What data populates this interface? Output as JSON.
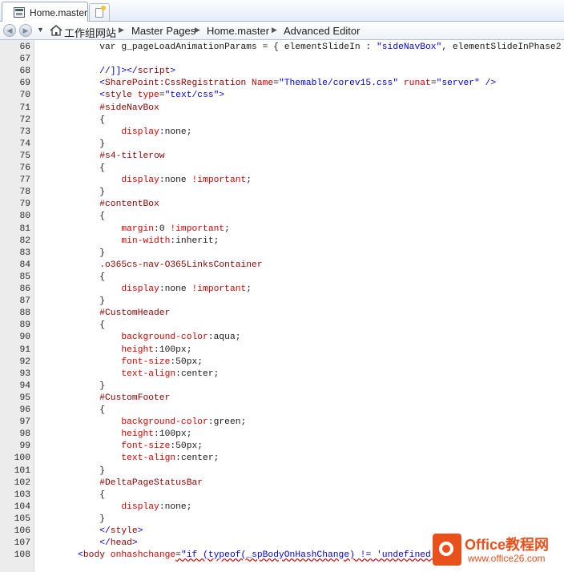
{
  "tab": {
    "label": "Home.master"
  },
  "breadcrumb": [
    "工作组网站",
    "Master Pages",
    "Home.master",
    "Advanced Editor"
  ],
  "code_lines": [
    {
      "n": "66",
      "t": [
        [
          "        var g_pageLoadAnimationParams = { elementSlideIn : ",
          "b"
        ],
        [
          "\"sideNavBox\"",
          "blue"
        ],
        [
          ", elementSlideInPhase2",
          "b"
        ]
      ]
    },
    {
      "n": "67",
      "t": []
    },
    {
      "n": "68",
      "t": [
        [
          "        //]]></",
          "blue"
        ],
        [
          "script",
          "maroon"
        ],
        [
          ">",
          "blue"
        ]
      ]
    },
    {
      "n": "69",
      "t": [
        [
          "        <",
          "blue"
        ],
        [
          "SharePoint:CssRegistration",
          "maroon"
        ],
        [
          " Name",
          "red"
        ],
        [
          "=",
          "b"
        ],
        [
          "\"Themable/corev15.css\"",
          "blue"
        ],
        [
          " runat",
          "red"
        ],
        [
          "=",
          "b"
        ],
        [
          "\"server\"",
          "blue"
        ],
        [
          " />",
          "blue"
        ]
      ]
    },
    {
      "n": "70",
      "t": [
        [
          "        <",
          "blue"
        ],
        [
          "style",
          "maroon"
        ],
        [
          " type",
          "red"
        ],
        [
          "=",
          "b"
        ],
        [
          "\"text/css\"",
          "blue"
        ],
        [
          ">",
          "blue"
        ]
      ]
    },
    {
      "n": "71",
      "t": [
        [
          "        #sideNavBox",
          "maroon"
        ]
      ]
    },
    {
      "n": "72",
      "t": [
        [
          "        {",
          "b"
        ]
      ]
    },
    {
      "n": "73",
      "t": [
        [
          "            display",
          "red"
        ],
        [
          ":",
          "b"
        ],
        [
          "none",
          "b"
        ],
        [
          ";",
          "b"
        ]
      ]
    },
    {
      "n": "74",
      "t": [
        [
          "        }",
          "b"
        ]
      ]
    },
    {
      "n": "75",
      "t": [
        [
          "        #s4-titlerow",
          "maroon"
        ]
      ]
    },
    {
      "n": "76",
      "t": [
        [
          "        {",
          "b"
        ]
      ]
    },
    {
      "n": "77",
      "t": [
        [
          "            display",
          "red"
        ],
        [
          ":",
          "b"
        ],
        [
          "none ",
          "b"
        ],
        [
          "!important",
          "red"
        ],
        [
          ";",
          "b"
        ]
      ]
    },
    {
      "n": "78",
      "t": [
        [
          "        }",
          "b"
        ]
      ]
    },
    {
      "n": "79",
      "t": [
        [
          "        #contentBox",
          "maroon"
        ]
      ]
    },
    {
      "n": "80",
      "t": [
        [
          "        {",
          "b"
        ]
      ]
    },
    {
      "n": "81",
      "t": [
        [
          "            margin",
          "red"
        ],
        [
          ":",
          "b"
        ],
        [
          "0 ",
          "b"
        ],
        [
          "!important",
          "red"
        ],
        [
          ";",
          "b"
        ]
      ]
    },
    {
      "n": "82",
      "t": [
        [
          "            min-width",
          "red"
        ],
        [
          ":",
          "b"
        ],
        [
          "inherit",
          "b"
        ],
        [
          ";",
          "b"
        ]
      ]
    },
    {
      "n": "83",
      "t": [
        [
          "        }",
          "b"
        ]
      ]
    },
    {
      "n": "84",
      "t": [
        [
          "        .o365cs-nav-O365LinksContainer",
          "maroon"
        ]
      ]
    },
    {
      "n": "85",
      "t": [
        [
          "        {",
          "b"
        ]
      ]
    },
    {
      "n": "86",
      "t": [
        [
          "            display",
          "red"
        ],
        [
          ":",
          "b"
        ],
        [
          "none ",
          "b"
        ],
        [
          "!important",
          "red"
        ],
        [
          ";",
          "b"
        ]
      ]
    },
    {
      "n": "87",
      "t": [
        [
          "        }",
          "b"
        ]
      ]
    },
    {
      "n": "88",
      "t": [
        [
          "        #CustomHeader",
          "maroon"
        ]
      ]
    },
    {
      "n": "89",
      "t": [
        [
          "        {",
          "b"
        ]
      ]
    },
    {
      "n": "90",
      "t": [
        [
          "            background-color",
          "red"
        ],
        [
          ":",
          "b"
        ],
        [
          "aqua",
          "b"
        ],
        [
          ";",
          "b"
        ]
      ]
    },
    {
      "n": "91",
      "t": [
        [
          "            height",
          "red"
        ],
        [
          ":",
          "b"
        ],
        [
          "100px",
          "b"
        ],
        [
          ";",
          "b"
        ]
      ]
    },
    {
      "n": "92",
      "t": [
        [
          "            font-size",
          "red"
        ],
        [
          ":",
          "b"
        ],
        [
          "50px",
          "b"
        ],
        [
          ";",
          "b"
        ]
      ]
    },
    {
      "n": "93",
      "t": [
        [
          "            text-align",
          "red"
        ],
        [
          ":",
          "b"
        ],
        [
          "center",
          "b"
        ],
        [
          ";",
          "b"
        ]
      ]
    },
    {
      "n": "94",
      "t": [
        [
          "        }",
          "b"
        ]
      ]
    },
    {
      "n": "95",
      "t": [
        [
          "        #CustomFooter",
          "maroon"
        ]
      ]
    },
    {
      "n": "96",
      "t": [
        [
          "        {",
          "b"
        ]
      ]
    },
    {
      "n": "97",
      "t": [
        [
          "            background-color",
          "red"
        ],
        [
          ":",
          "b"
        ],
        [
          "green",
          "b"
        ],
        [
          ";",
          "b"
        ]
      ]
    },
    {
      "n": "98",
      "t": [
        [
          "            height",
          "red"
        ],
        [
          ":",
          "b"
        ],
        [
          "100px",
          "b"
        ],
        [
          ";",
          "b"
        ]
      ]
    },
    {
      "n": "99",
      "t": [
        [
          "            font-size",
          "red"
        ],
        [
          ":",
          "b"
        ],
        [
          "50px",
          "b"
        ],
        [
          ";",
          "b"
        ]
      ]
    },
    {
      "n": "100",
      "t": [
        [
          "            text-align",
          "red"
        ],
        [
          ":",
          "b"
        ],
        [
          "center",
          "b"
        ],
        [
          ";",
          "b"
        ]
      ]
    },
    {
      "n": "101",
      "t": [
        [
          "        }",
          "b"
        ]
      ]
    },
    {
      "n": "102",
      "t": [
        [
          "        #DeltaPageStatusBar",
          "maroon"
        ]
      ]
    },
    {
      "n": "103",
      "t": [
        [
          "        {",
          "b"
        ]
      ]
    },
    {
      "n": "104",
      "t": [
        [
          "            display",
          "red"
        ],
        [
          ":",
          "b"
        ],
        [
          "none",
          "b"
        ],
        [
          ";",
          "b"
        ]
      ]
    },
    {
      "n": "105",
      "t": [
        [
          "        }",
          "b"
        ]
      ]
    },
    {
      "n": "106",
      "t": [
        [
          "        </",
          "blue"
        ],
        [
          "style",
          "maroon"
        ],
        [
          ">",
          "blue"
        ]
      ]
    },
    {
      "n": "107",
      "t": [
        [
          "        </",
          "blue"
        ],
        [
          "head",
          "maroon"
        ],
        [
          ">",
          "blue"
        ]
      ]
    },
    {
      "n": "108",
      "t": [
        [
          "    <",
          "blue"
        ],
        [
          "body",
          "maroon"
        ],
        [
          " onhashchange",
          "red"
        ],
        [
          "=",
          "b"
        ],
        [
          "\"if (typeof(_spBodyOnHashChange) != 'undefined')",
          "blue"
        ]
      ]
    }
  ],
  "watermark": {
    "brand": "Office教程网",
    "url": "www.office26.com"
  },
  "colors": {
    "blue": "#0000e0",
    "red": "#d00000",
    "maroon": "#8b0000"
  }
}
